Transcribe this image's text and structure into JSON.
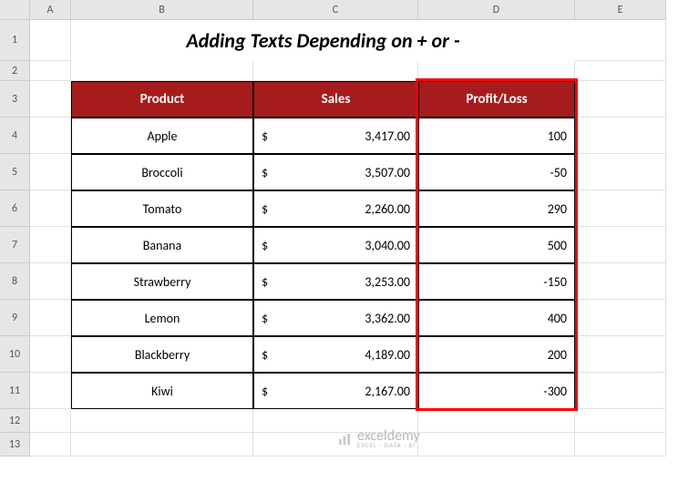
{
  "columns": [
    "",
    "A",
    "B",
    "C",
    "D",
    "E"
  ],
  "rows": [
    "1",
    "2",
    "3",
    "4",
    "5",
    "6",
    "7",
    "8",
    "9",
    "10",
    "11",
    "12",
    "13"
  ],
  "title": "Adding Texts Depending on + or -",
  "headers": {
    "product": "Product",
    "sales": "Sales",
    "profitloss": "Profit/Loss"
  },
  "data": [
    {
      "product": "Apple",
      "currency": "$",
      "sales": "3,417.00",
      "pl": "100"
    },
    {
      "product": "Broccoli",
      "currency": "$",
      "sales": "3,507.00",
      "pl": "-50"
    },
    {
      "product": "Tomato",
      "currency": "$",
      "sales": "2,260.00",
      "pl": "290"
    },
    {
      "product": "Banana",
      "currency": "$",
      "sales": "3,040.00",
      "pl": "500"
    },
    {
      "product": "Strawberry",
      "currency": "$",
      "sales": "3,253.00",
      "pl": "-150"
    },
    {
      "product": "Lemon",
      "currency": "$",
      "sales": "3,362.00",
      "pl": "400"
    },
    {
      "product": "Blackberry",
      "currency": "$",
      "sales": "4,189.00",
      "pl": "200"
    },
    {
      "product": "Kiwi",
      "currency": "$",
      "sales": "2,167.00",
      "pl": "-300"
    }
  ],
  "watermark": {
    "brand": "exceldemy",
    "sub": "EXCEL · DATA · BI"
  },
  "chart_data": {
    "type": "table",
    "title": "Adding Texts Depending on + or -",
    "columns": [
      "Product",
      "Sales",
      "Profit/Loss"
    ],
    "rows": [
      [
        "Apple",
        3417.0,
        100
      ],
      [
        "Broccoli",
        3507.0,
        -50
      ],
      [
        "Tomato",
        2260.0,
        290
      ],
      [
        "Banana",
        3040.0,
        500
      ],
      [
        "Strawberry",
        3253.0,
        -150
      ],
      [
        "Lemon",
        3362.0,
        400
      ],
      [
        "Blackberry",
        4189.0,
        200
      ],
      [
        "Kiwi",
        2167.0,
        -300
      ]
    ]
  }
}
